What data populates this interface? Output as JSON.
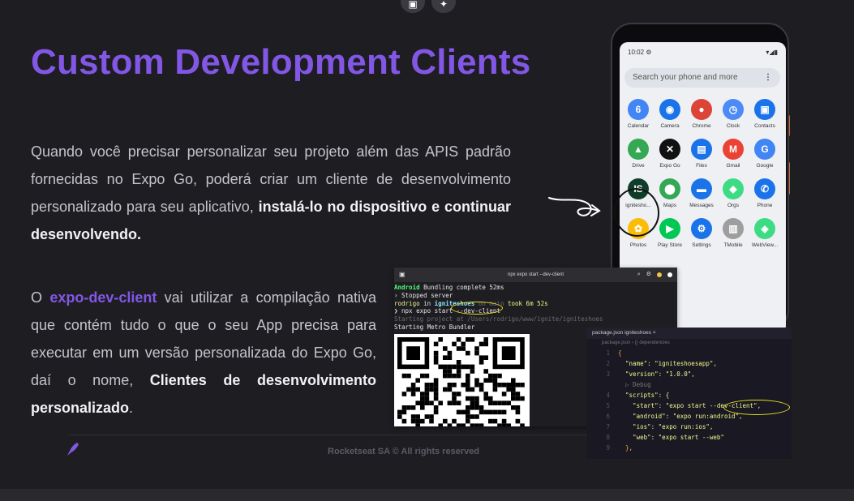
{
  "toolbar": {
    "icon1": "edit-icon",
    "icon2": "sparkle-icon"
  },
  "slide": {
    "title": "Custom Development Clients",
    "p1_a": "Quando você precisar personalizar seu projeto além das APIS padrão fornecidas no Expo Go, poderá criar um cliente de desenvolvimento personalizado para seu aplicativo, ",
    "p1_b": "instalá-lo no dispositivo e continuar desenvolvendo.",
    "p2_a": "O ",
    "p2_b": "expo-dev-client",
    "p2_c": " vai utilizar a compilação nativa que contém tudo o que o seu App precisa para executar em um versão personalizada do Expo Go, daí o nome, ",
    "p2_d": "Clientes de desenvolvimento personalizado",
    "p2_e": ".",
    "footer": "Rocketseat SA  © All rights reserved"
  },
  "phone": {
    "time": "10:02",
    "search_placeholder": "Search your phone and more",
    "apps": [
      {
        "label": "Calendar",
        "color": "#4285f4",
        "glyph": "6"
      },
      {
        "label": "Camera",
        "color": "#1a73e8",
        "glyph": "◉"
      },
      {
        "label": "Chrome",
        "color": "#db4437",
        "glyph": "●"
      },
      {
        "label": "Clock",
        "color": "#4c8bf5",
        "glyph": "◷"
      },
      {
        "label": "Contacts",
        "color": "#1a73e8",
        "glyph": "▣"
      },
      {
        "label": "Drive",
        "color": "#34a853",
        "glyph": "▲"
      },
      {
        "label": "Expo Go",
        "color": "#111111",
        "glyph": "✕"
      },
      {
        "label": "Files",
        "color": "#1a73e8",
        "glyph": "▤"
      },
      {
        "label": "Gmail",
        "color": "#ea4335",
        "glyph": "M"
      },
      {
        "label": "Google",
        "color": "#4285f4",
        "glyph": "G"
      },
      {
        "label": "ignitesho...",
        "color": "#0f3d2a",
        "glyph": "IS"
      },
      {
        "label": "Maps",
        "color": "#34a853",
        "glyph": "⬤"
      },
      {
        "label": "Messages",
        "color": "#1a73e8",
        "glyph": "▬"
      },
      {
        "label": "Orgs",
        "color": "#3ddc84",
        "glyph": "◆"
      },
      {
        "label": "Phone",
        "color": "#1a73e8",
        "glyph": "✆"
      },
      {
        "label": "Photos",
        "color": "#fbbc05",
        "glyph": "✿"
      },
      {
        "label": "Play Store",
        "color": "#00c853",
        "glyph": "▶"
      },
      {
        "label": "Settings",
        "color": "#1a73e8",
        "glyph": "⚙"
      },
      {
        "label": "TMobile",
        "color": "#9e9e9e",
        "glyph": "▥"
      },
      {
        "label": "WebView...",
        "color": "#3ddc84",
        "glyph": "◈"
      }
    ]
  },
  "terminal": {
    "title": "npx expo start --dev-client",
    "line1_a": "Android",
    "line1_b": " Bundling complete 52ms",
    "line2": "› Stopped server",
    "line3_a": "rodrigo",
    "line3_b": " in ",
    "line3_c": "igniteshoes",
    "line3_d": " on ",
    "line3_e": "main",
    "line3_f": " took 6m 52s",
    "line4": "❯ npx expo start --dev-client",
    "line5": "Starting project at /Users/rodrigo/www/ignite/igniteshoes",
    "line6": "Starting Metro Bundler"
  },
  "editor": {
    "tab": "package.json  igniteshoes",
    "crumb": "package.json › {} dependencies",
    "lines": [
      {
        "n": "1",
        "t": "{"
      },
      {
        "n": "2",
        "t": "  \"name\": \"igniteshoesapp\","
      },
      {
        "n": "3",
        "t": "  \"version\": \"1.0.0\","
      },
      {
        "n": "",
        "t": "  ▷ Debug"
      },
      {
        "n": "4",
        "t": "  \"scripts\": {"
      },
      {
        "n": "5",
        "t": "    \"start\": \"expo start --dev-client\","
      },
      {
        "n": "6",
        "t": "    \"android\": \"expo run:android\","
      },
      {
        "n": "7",
        "t": "    \"ios\": \"expo run:ios\","
      },
      {
        "n": "8",
        "t": "    \"web\": \"expo start --web\""
      },
      {
        "n": "9",
        "t": "  },"
      }
    ]
  }
}
